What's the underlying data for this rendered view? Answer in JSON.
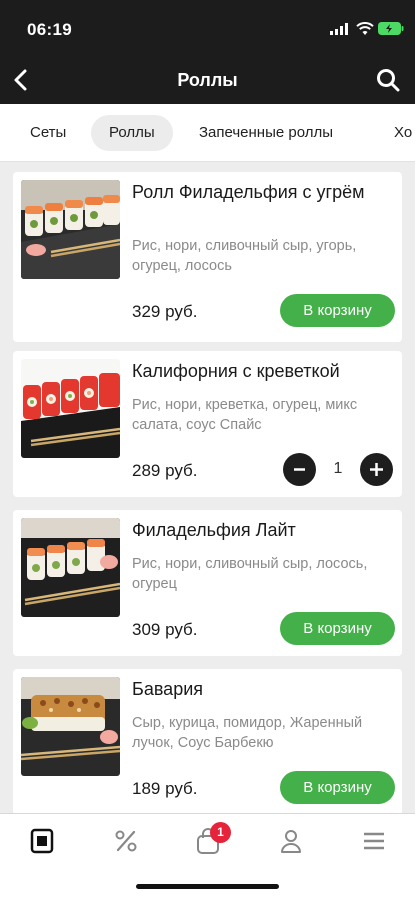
{
  "status_bar": {
    "time": "06:19"
  },
  "header": {
    "title": "Роллы",
    "back_icon": "chevron-left-icon",
    "search_icon": "search-icon"
  },
  "categories": [
    {
      "label": "Сеты",
      "active": false
    },
    {
      "label": "Роллы",
      "active": true
    },
    {
      "label": "Запеченные роллы",
      "active": false
    },
    {
      "label": "Хо",
      "active": false
    }
  ],
  "products": [
    {
      "title": "Ролл Филадельфия с угрём",
      "description": "Рис, нори, сливочный сыр, угорь, огурец, лосось",
      "price": "329 руб.",
      "button_label": "В корзину"
    },
    {
      "title": "Калифорния с креветкой",
      "description": "Рис, нори, креветка, огурец, микс салата, соус Спайс",
      "price": "289 руб.",
      "quantity": "1"
    },
    {
      "title": "Филадельфия Лайт",
      "description": "Рис, нори, сливочный сыр, лосось, огурец",
      "price": "309 руб.",
      "button_label": "В корзину"
    },
    {
      "title": "Бавария",
      "description": "Сыр, курица, помидор, Жаренный лучок, Соус Барбекю",
      "price": "189 руб.",
      "button_label": "В корзину"
    }
  ],
  "tab_bar": {
    "items": [
      "menu-icon",
      "discount-icon",
      "cart-icon",
      "profile-icon",
      "hamburger-icon"
    ],
    "cart_badge": "1"
  },
  "colors": {
    "header_bg": "#1c1c1c",
    "accent_green": "#43b049",
    "badge_red": "#e5243b"
  }
}
